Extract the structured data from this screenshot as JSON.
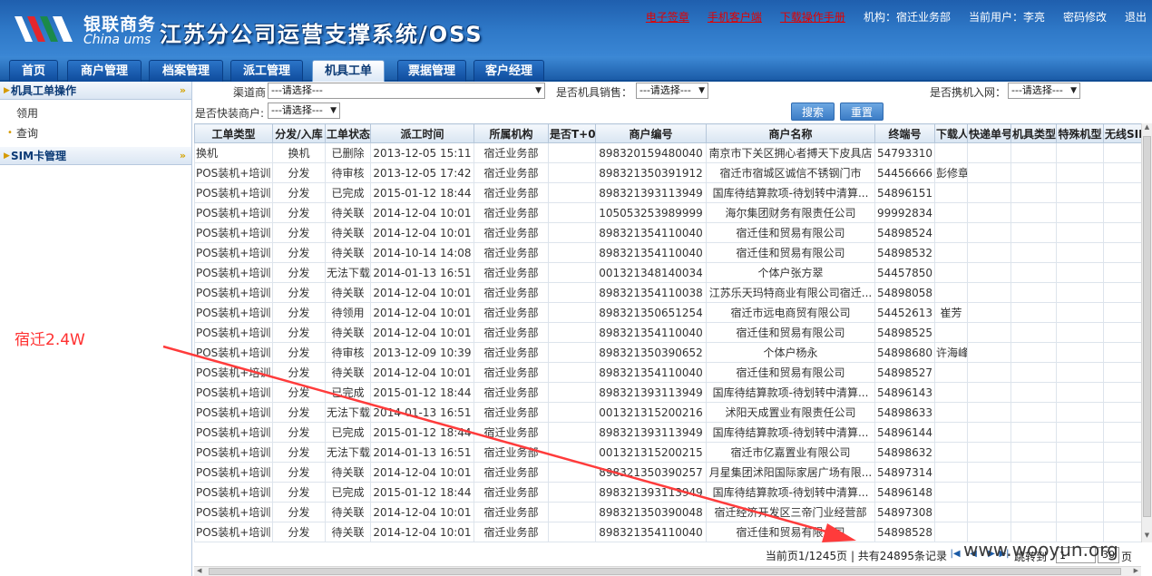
{
  "header": {
    "logo_cn": "银联商务",
    "logo_en": "China ums",
    "system_title": "江苏分公司运营支撑系统/OSS",
    "links": [
      {
        "label": "电子签章",
        "style": "red"
      },
      {
        "label": "手机客户端",
        "style": "red"
      },
      {
        "label": "下载操作手册",
        "style": "red"
      },
      {
        "label": "机构：宿迁业务部",
        "style": "white"
      },
      {
        "label": "当前用户：李亮",
        "style": "white"
      },
      {
        "label": "密码修改",
        "style": "white"
      },
      {
        "label": "退出",
        "style": "white"
      }
    ]
  },
  "nav": {
    "tabs": [
      {
        "label": "首页",
        "active": false
      },
      {
        "label": "商户管理",
        "active": false
      },
      {
        "label": "档案管理",
        "active": false
      },
      {
        "label": "派工管理",
        "active": false
      },
      {
        "label": "机具工单",
        "active": true
      },
      {
        "label": "票据管理",
        "active": false
      },
      {
        "label": "客户经理",
        "active": false
      }
    ]
  },
  "sidebar": {
    "group1": "机具工单操作",
    "item1": "领用",
    "item2": "查询",
    "group2": "SIM卡管理"
  },
  "filters": {
    "channel_label": "渠道商",
    "channel_value": "---请选择---",
    "pos_sale_label": "是否机具销售：",
    "pos_sale_value": "---请选择---",
    "portable_label": "是否携机入网：",
    "portable_value": "---请选择---",
    "quick_label": "是否快装商户:",
    "quick_value": "---请选择---",
    "search_button": "搜索",
    "reset_button": "重置"
  },
  "grid": {
    "columns": [
      "工单类型",
      "分发/入库",
      "工单状态",
      "派工时间",
      "所属机构",
      "是否T+0",
      "商户编号",
      "商户名称",
      "终端号",
      "下载人",
      "快递单号",
      "机具类型",
      "特殊机型",
      "无线SIM信息"
    ],
    "rows": [
      [
        "换机",
        "换机",
        "已删除",
        "2013-12-05 15:11",
        "宿迁业务部",
        "",
        "898320159480040",
        "南京市下关区拥心者搏天下皮具店",
        "54793310",
        "",
        "",
        "",
        "",
        ""
      ],
      [
        "POS装机+培训",
        "分发",
        "待审核",
        "2013-12-05 17:42",
        "宿迁业务部",
        "",
        "898321350391912",
        "宿迁市宿城区诚信不锈钢门市",
        "54456666",
        "彭修章",
        "",
        "",
        "",
        ""
      ],
      [
        "POS装机+培训",
        "分发",
        "已完成",
        "2015-01-12 18:44",
        "宿迁业务部",
        "",
        "898321393113949",
        "国库待结算款项-待划转中清算...",
        "54896151",
        "",
        "",
        "",
        "",
        ""
      ],
      [
        "POS装机+培训",
        "分发",
        "待关联",
        "2014-12-04 10:01",
        "宿迁业务部",
        "",
        "105053253989999",
        "海尔集团财务有限责任公司",
        "99992834",
        "",
        "",
        "",
        "",
        ""
      ],
      [
        "POS装机+培训",
        "分发",
        "待关联",
        "2014-12-04 10:01",
        "宿迁业务部",
        "",
        "898321354110040",
        "宿迁佳和贸易有限公司",
        "54898524",
        "",
        "",
        "",
        "",
        ""
      ],
      [
        "POS装机+培训",
        "分发",
        "待关联",
        "2014-10-14 14:08",
        "宿迁业务部",
        "",
        "898321354110040",
        "宿迁佳和贸易有限公司",
        "54898532",
        "",
        "",
        "",
        "",
        ""
      ],
      [
        "POS装机+培训",
        "分发",
        "无法下载",
        "2014-01-13 16:51",
        "宿迁业务部",
        "",
        "001321348140034",
        "个体户张方翠",
        "54457850",
        "",
        "",
        "",
        "",
        ""
      ],
      [
        "POS装机+培训",
        "分发",
        "待关联",
        "2014-12-04 10:01",
        "宿迁业务部",
        "",
        "898321354110038",
        "江苏乐天玛特商业有限公司宿迁...",
        "54898058",
        "",
        "",
        "",
        "",
        ""
      ],
      [
        "POS装机+培训",
        "分发",
        "待领用",
        "2014-12-04 10:01",
        "宿迁业务部",
        "",
        "898321350651254",
        "宿迁市远电商贸有限公司",
        "54452613",
        "崔芳",
        "",
        "",
        "",
        ""
      ],
      [
        "POS装机+培训",
        "分发",
        "待关联",
        "2014-12-04 10:01",
        "宿迁业务部",
        "",
        "898321354110040",
        "宿迁佳和贸易有限公司",
        "54898525",
        "",
        "",
        "",
        "",
        ""
      ],
      [
        "POS装机+培训",
        "分发",
        "待审核",
        "2013-12-09 10:39",
        "宿迁业务部",
        "",
        "898321350390652",
        "个体户杨永",
        "54898680",
        "许海峰",
        "",
        "",
        "",
        ""
      ],
      [
        "POS装机+培训",
        "分发",
        "待关联",
        "2014-12-04 10:01",
        "宿迁业务部",
        "",
        "898321354110040",
        "宿迁佳和贸易有限公司",
        "54898527",
        "",
        "",
        "",
        "",
        ""
      ],
      [
        "POS装机+培训",
        "分发",
        "已完成",
        "2015-01-12 18:44",
        "宿迁业务部",
        "",
        "898321393113949",
        "国库待结算款项-待划转中清算...",
        "54896143",
        "",
        "",
        "",
        "",
        ""
      ],
      [
        "POS装机+培训",
        "分发",
        "无法下载",
        "2014-01-13 16:51",
        "宿迁业务部",
        "",
        "001321315200216",
        "沭阳天成置业有限责任公司",
        "54898633",
        "",
        "",
        "",
        "",
        ""
      ],
      [
        "POS装机+培训",
        "分发",
        "已完成",
        "2015-01-12 18:44",
        "宿迁业务部",
        "",
        "898321393113949",
        "国库待结算款项-待划转中清算...",
        "54896144",
        "",
        "",
        "",
        "",
        ""
      ],
      [
        "POS装机+培训",
        "分发",
        "无法下载",
        "2014-01-13 16:51",
        "宿迁业务部",
        "",
        "001321315200215",
        "宿迁市亿嘉置业有限公司",
        "54898632",
        "",
        "",
        "",
        "",
        ""
      ],
      [
        "POS装机+培训",
        "分发",
        "待关联",
        "2014-12-04 10:01",
        "宿迁业务部",
        "",
        "898321350390257",
        "月星集团沭阳国际家居广场有限...",
        "54897314",
        "",
        "",
        "",
        "",
        ""
      ],
      [
        "POS装机+培训",
        "分发",
        "已完成",
        "2015-01-12 18:44",
        "宿迁业务部",
        "",
        "898321393113949",
        "国库待结算款项-待划转中清算...",
        "54896148",
        "",
        "",
        "",
        "",
        ""
      ],
      [
        "POS装机+培训",
        "分发",
        "待关联",
        "2014-12-04 10:01",
        "宿迁业务部",
        "",
        "898321350390048",
        "宿迁经济开发区三帝门业经营部",
        "54897308",
        "",
        "",
        "",
        "",
        ""
      ],
      [
        "POS装机+培训",
        "分发",
        "待关联",
        "2014-12-04 10:01",
        "宿迁业务部",
        "",
        "898321354110040",
        "宿迁佳和贸易有限公司",
        "54898528",
        "",
        "",
        "",
        "",
        ""
      ]
    ]
  },
  "pager": {
    "summary": "当前页1/1245页 | 共有24895条记录",
    "goto_label": "跳转到",
    "page_value": "1",
    "page_size": "30",
    "unit": "页"
  },
  "annotation": {
    "text": "宿迁2.4W",
    "color": "#ff3030"
  },
  "watermark": "www.wooyun.org"
}
